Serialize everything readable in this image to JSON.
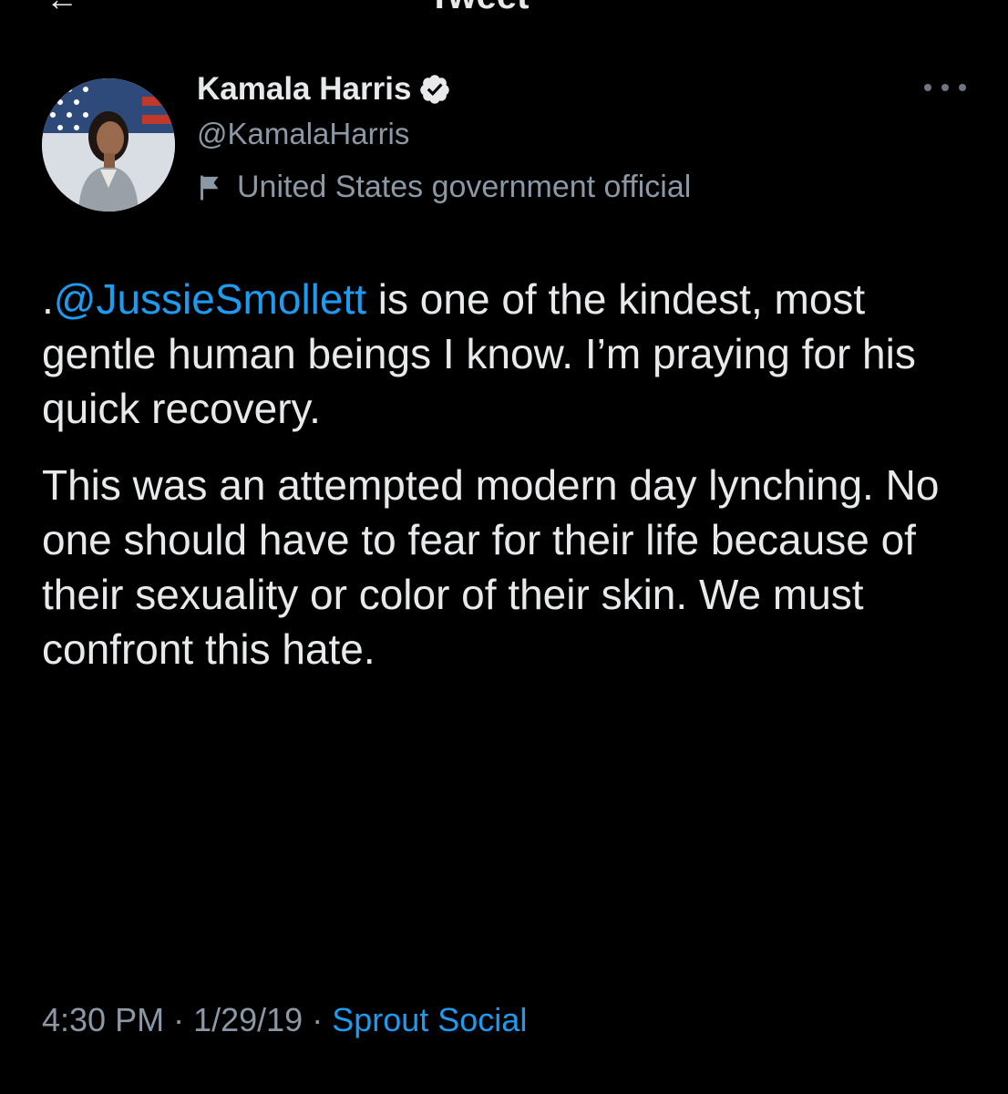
{
  "screen": {
    "back_icon": "back-arrow-icon",
    "header_title": "Tweet"
  },
  "author": {
    "name": "Kamala Harris",
    "handle": "@KamalaHarris",
    "verified": true,
    "verified_icon": "verified-badge-icon",
    "label": "United States government official",
    "label_icon": "flag-icon",
    "more_icon": "more-options-icon"
  },
  "tweet": {
    "mention": "@JussieSmollett",
    "paragraph1_prefix": ".",
    "paragraph1_rest": " is one of the kindest, most gentle human beings I know. I’m praying for his quick recovery.",
    "paragraph2": "This was an attempted modern day lynching. No one should have to fear for their life because of their sexuality or color of their skin. We must confront this hate."
  },
  "meta": {
    "time": "4:30 PM",
    "separator": "·",
    "date": "1/29/19",
    "source": "Sprout Social"
  },
  "colors": {
    "background": "#000000",
    "text": "#e7e9ea",
    "secondary": "#8b98a5",
    "link": "#1d9bf0"
  }
}
